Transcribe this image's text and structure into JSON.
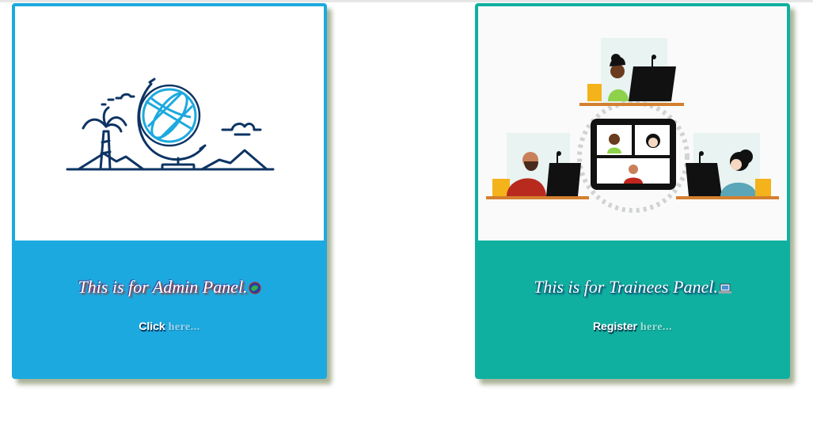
{
  "cards": {
    "admin": {
      "title": "This is for Admin Panel.",
      "title_icon": "globe-icon",
      "action_word": "Click",
      "action_link": "here...",
      "illustration": "globe-landscape-illustration",
      "color": "#1ca9df"
    },
    "trainee": {
      "title": "This is for Trainees Panel.",
      "title_icon": "laptop-icon",
      "action_word": "Register",
      "action_link": "here...",
      "illustration": "video-conference-illustration",
      "color": "#10b0a0"
    }
  }
}
